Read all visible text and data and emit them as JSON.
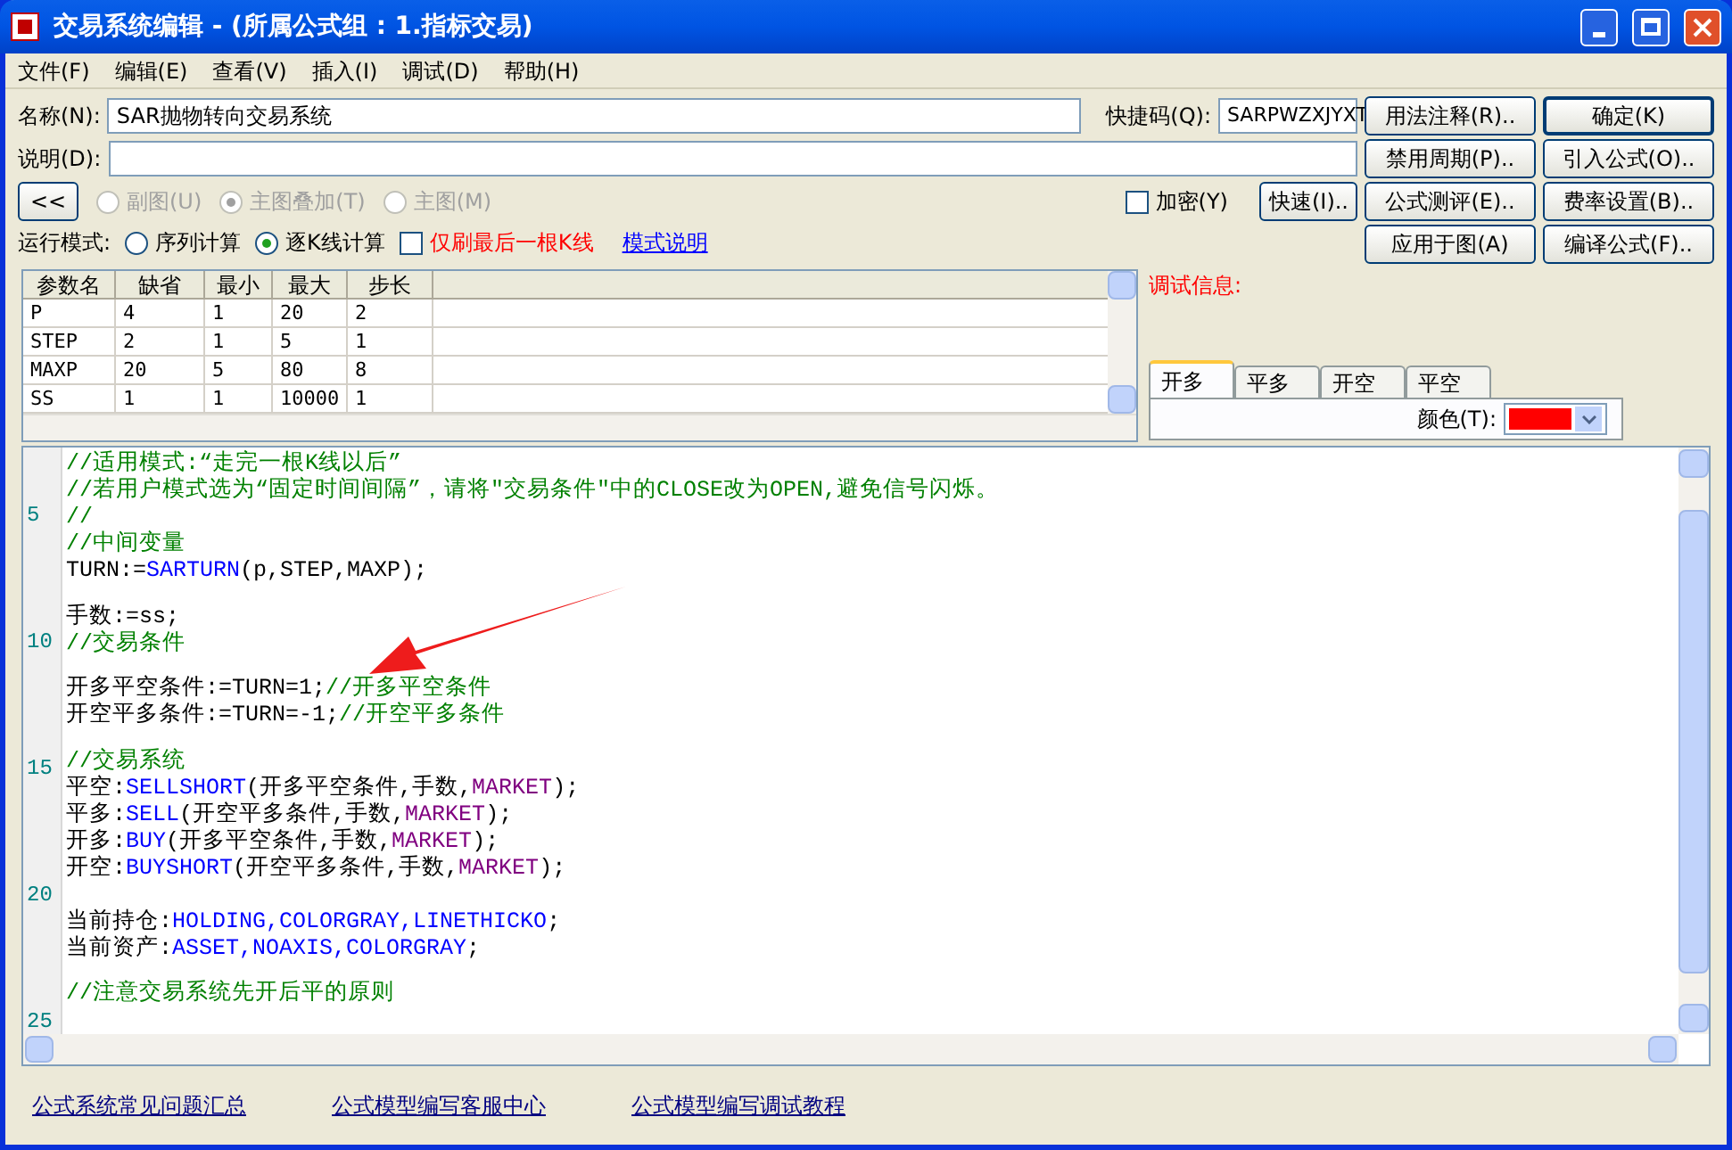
{
  "window": {
    "title": "交易系统编辑 - (所属公式组 : 1.指标交易)"
  },
  "menu": [
    "文件(F)",
    "编辑(E)",
    "查看(V)",
    "插入(I)",
    "调试(D)",
    "帮助(H)"
  ],
  "form": {
    "name_label": "名称(N):",
    "name_value": "SAR抛物转向交易系统",
    "shortcut_label": "快捷码(Q):",
    "shortcut_value": "SARPWZXJYXT",
    "desc_label": "说明(D):",
    "collapse_button": "<<",
    "chart_options": [
      {
        "label": "副图(U)",
        "selected": false,
        "disabled": true
      },
      {
        "label": "主图叠加(T)",
        "selected": true,
        "disabled": true
      },
      {
        "label": "主图(M)",
        "selected": false,
        "disabled": true
      }
    ],
    "encrypt": {
      "label": "加密(Y)",
      "checked": false
    },
    "quick_button": "快速(I)..",
    "run_mode_label": "运行模式:",
    "run_modes": [
      {
        "label": "序列计算",
        "selected": false
      },
      {
        "label": "逐K线计算",
        "selected": true
      }
    ],
    "refresh_last": {
      "label": "仅刷最后一根K线",
      "checked": false
    },
    "mode_link": "模式说明"
  },
  "buttons": [
    [
      "用法注释(R)..",
      "确定(K)"
    ],
    [
      "禁用周期(P)..",
      "引入公式(O).."
    ],
    [
      "公式测评(E)..",
      "费率设置(B).."
    ],
    [
      "应用于图(A)",
      "编译公式(F).."
    ]
  ],
  "params": {
    "columns": [
      "参数名",
      "缺省",
      "最小",
      "最大",
      "步长"
    ],
    "rows": [
      [
        "P",
        "4",
        "1",
        "20",
        "2"
      ],
      [
        "STEP",
        "2",
        "1",
        "5",
        "1"
      ],
      [
        "MAXP",
        "20",
        "5",
        "80",
        "8"
      ],
      [
        "SS",
        "1",
        "1",
        "10000",
        "1"
      ]
    ]
  },
  "debug_label": "调试信息:",
  "signal_tabs": [
    {
      "label": "开多",
      "selected": true
    },
    {
      "label": "平多",
      "selected": false
    },
    {
      "label": "开空",
      "selected": false
    },
    {
      "label": "平空",
      "selected": false
    }
  ],
  "color_picker": {
    "label": "颜色(T):",
    "color": "#ff0000"
  },
  "editor": {
    "lines": [
      {
        "segments": [
          {
            "kind": "comment",
            "text": "//适用模式:“走完一根K线以后”"
          }
        ]
      },
      {
        "segments": [
          {
            "kind": "comment",
            "text": "//若用户模式选为“固定时间间隔”，请将″交易条件″中的CLOSE改为OPEN,避免信号闪烁。"
          }
        ]
      },
      {
        "number": "5",
        "segments": [
          {
            "kind": "comment",
            "text": "//"
          }
        ]
      },
      {
        "segments": [
          {
            "kind": "comment",
            "text": "//中间变量"
          }
        ]
      },
      {
        "segments": [
          {
            "kind": "plain",
            "text": "TURN:="
          },
          {
            "kind": "function",
            "text": "SARTURN"
          },
          {
            "kind": "plain",
            "text": "(p,STEP,MAXP);"
          }
        ]
      },
      {
        "kind": "blank"
      },
      {
        "segments": [
          {
            "kind": "plain",
            "text": "手数:=ss;"
          }
        ]
      },
      {
        "number": "10",
        "segments": [
          {
            "kind": "comment",
            "text": "//交易条件"
          }
        ]
      },
      {
        "kind": "blank"
      },
      {
        "segments": [
          {
            "kind": "plain",
            "text": "开多平空条件:=TURN=1;"
          },
          {
            "kind": "comment",
            "text": "//开多平空条件"
          }
        ]
      },
      {
        "segments": [
          {
            "kind": "plain",
            "text": "开空平多条件:=TURN=-1;"
          },
          {
            "kind": "comment",
            "text": "//开空平多条件"
          }
        ]
      },
      {
        "kind": "blank"
      },
      {
        "number": "15",
        "segments": [
          {
            "kind": "comment",
            "text": "//交易系统"
          }
        ]
      },
      {
        "segments": [
          {
            "kind": "plain",
            "text": "平空:"
          },
          {
            "kind": "function",
            "text": "SELLSHORT"
          },
          {
            "kind": "plain",
            "text": "(开多平空条件,手数,"
          },
          {
            "kind": "constant",
            "text": "MARKET"
          },
          {
            "kind": "plain",
            "text": ");"
          }
        ]
      },
      {
        "segments": [
          {
            "kind": "plain",
            "text": "平多:"
          },
          {
            "kind": "function",
            "text": "SELL"
          },
          {
            "kind": "plain",
            "text": "(开空平多条件,手数,"
          },
          {
            "kind": "constant",
            "text": "MARKET"
          },
          {
            "kind": "plain",
            "text": ");"
          }
        ]
      },
      {
        "segments": [
          {
            "kind": "plain",
            "text": "开多:"
          },
          {
            "kind": "function",
            "text": "BUY"
          },
          {
            "kind": "plain",
            "text": "(开多平空条件,手数,"
          },
          {
            "kind": "constant",
            "text": "MARKET"
          },
          {
            "kind": "plain",
            "text": ");"
          }
        ]
      },
      {
        "segments": [
          {
            "kind": "plain",
            "text": "开空:"
          },
          {
            "kind": "function",
            "text": "BUYSHORT"
          },
          {
            "kind": "plain",
            "text": "(开空平多条件,手数,"
          },
          {
            "kind": "constant",
            "text": "MARKET"
          },
          {
            "kind": "plain",
            "text": ");"
          }
        ]
      },
      {
        "number": "20"
      },
      {
        "segments": [
          {
            "kind": "plain",
            "text": "当前持仓:"
          },
          {
            "kind": "function",
            "text": "HOLDING,COLORGRAY,LINETHICKO"
          },
          {
            "kind": "plain",
            "text": ";"
          }
        ]
      },
      {
        "segments": [
          {
            "kind": "plain",
            "text": "当前资产:"
          },
          {
            "kind": "function",
            "text": "ASSET,NOAXIS,COLORGRAY"
          },
          {
            "kind": "plain",
            "text": ";"
          }
        ]
      },
      {
        "kind": "blank"
      },
      {
        "segments": [
          {
            "kind": "comment",
            "text": "//注意交易系统先开后平的原则"
          }
        ]
      },
      {
        "number": "25"
      }
    ]
  },
  "footer_links": [
    "公式系统常见问题汇总",
    "公式模型编写客服中心",
    "公式模型编写调试教程"
  ]
}
